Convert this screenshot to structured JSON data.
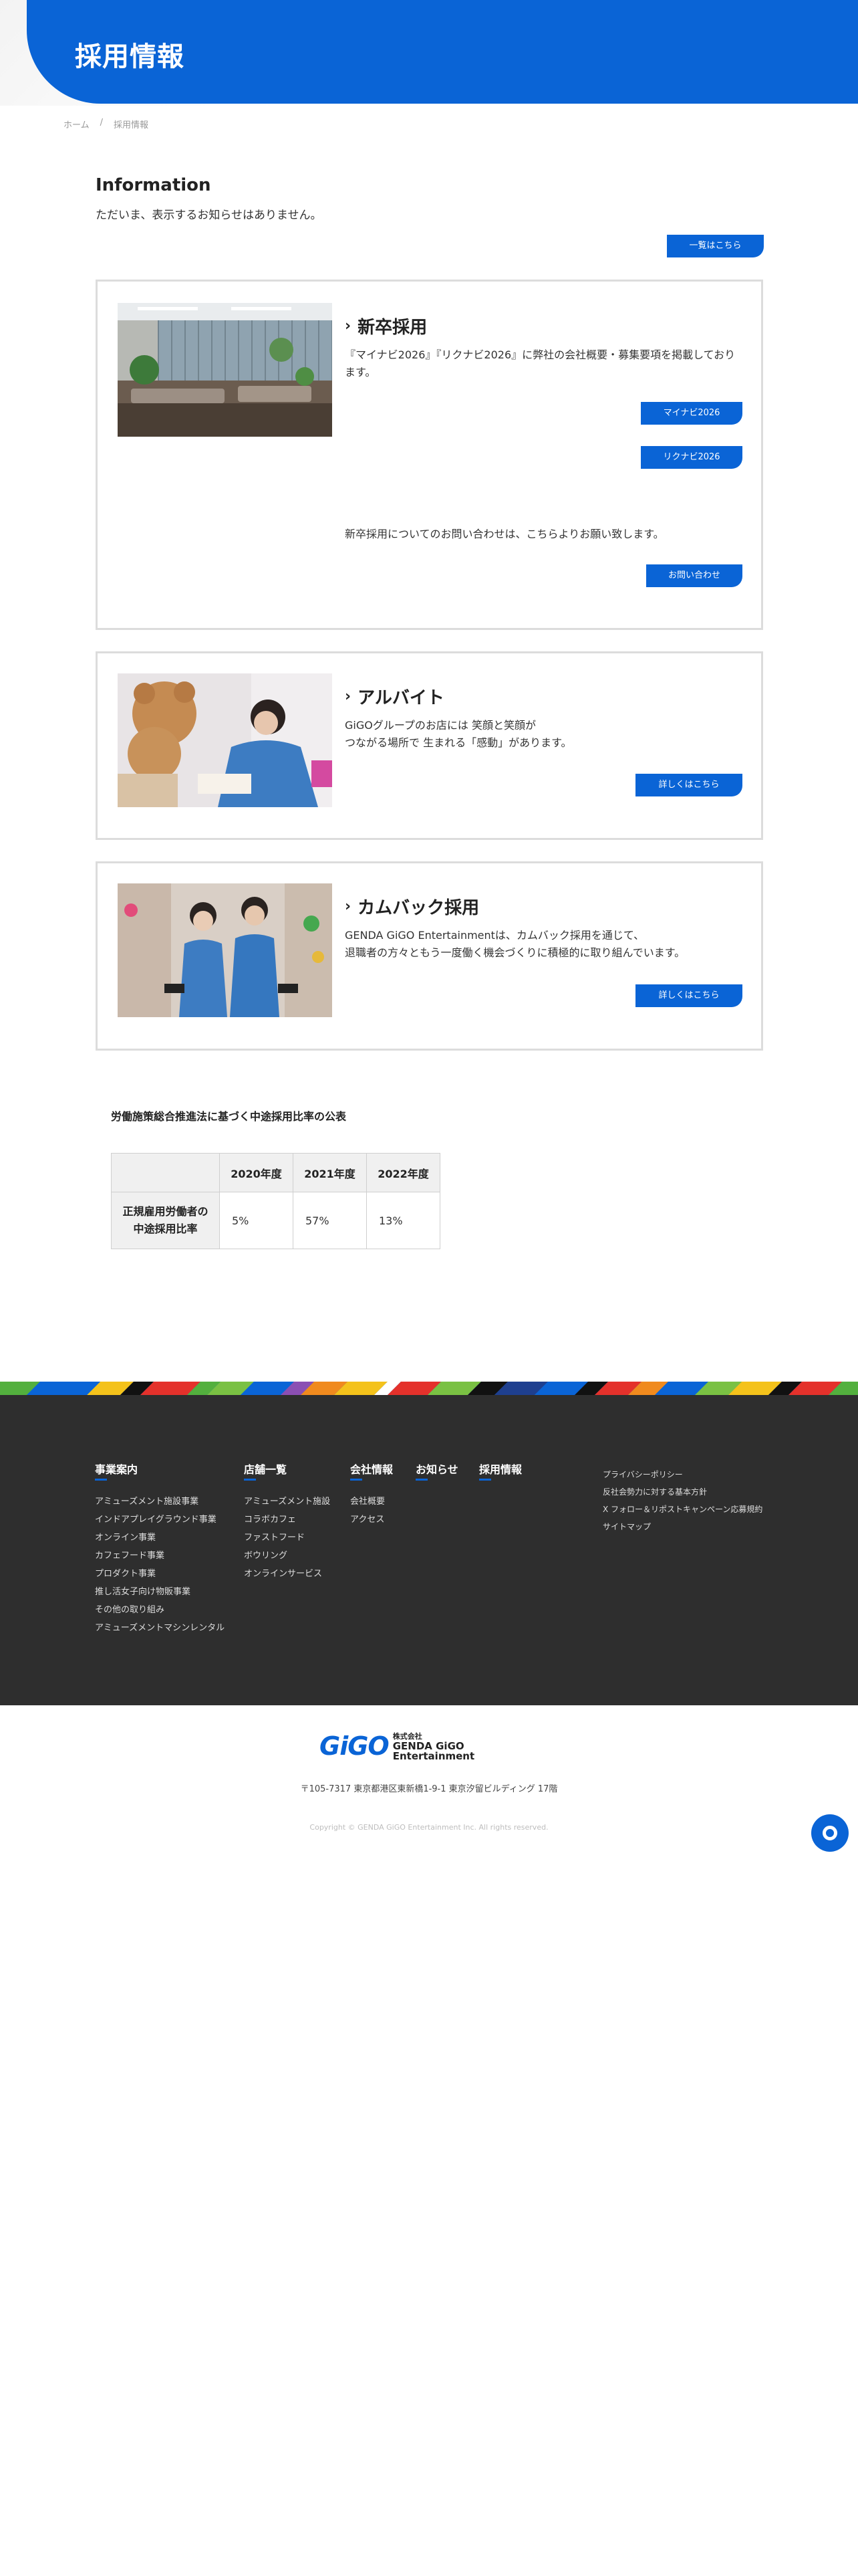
{
  "header": {
    "title": "採用情報"
  },
  "breadcrumb": {
    "home": "ホーム",
    "sep": "/",
    "current": "採用情報"
  },
  "information": {
    "title": "Information",
    "message": "ただいま、表示するお知らせはありません。",
    "list_button": "一覧はこちら"
  },
  "cards": {
    "newgrad": {
      "title": "新卒採用",
      "desc": "『マイナビ2026』『リクナビ2026』に弊社の会社概要・募集要項を掲載しており\nます。",
      "btn1": "マイナビ2026",
      "btn2": "リクナビ2026",
      "contact_text": "新卒採用についてのお問い合わせは、こちらよりお願い致します。",
      "contact_btn": "お問い合わせ"
    },
    "parttime": {
      "title": "アルバイト",
      "desc": "GiGOグループのお店には 笑顔と笑顔が\nつながる場所で 生まれる「感動」があります。",
      "btn": "詳しくはこちら"
    },
    "comeback": {
      "title": "カムバック採用",
      "desc": "GENDA GiGO Entertainmentは、カムバック採用を通じて、\n退職者の方々ともう一度働く機会づくりに積極的に取り組んでいます。",
      "btn": "詳しくはこちら"
    }
  },
  "law": {
    "title": "労働施策総合推進法に基づく中途採用比率の公表",
    "headers": [
      "2020年度",
      "2021年度",
      "2022年度"
    ],
    "row_label_1": "正規雇用労働者の",
    "row_label_2": "中途採用比率",
    "values": [
      "5%",
      "57%",
      "13%"
    ]
  },
  "footer": {
    "business": {
      "title": "事業案内",
      "items": [
        "アミューズメント施設事業",
        "インドアプレイグラウンド事業",
        "オンライン事業",
        "カフェフード事業",
        "プロダクト事業",
        "推し活女子向け物販事業",
        "その他の取り組み",
        "アミューズメントマシンレンタル"
      ]
    },
    "stores": {
      "title": "店舗一覧",
      "items": [
        "アミューズメント施設",
        "コラボカフェ",
        "ファストフード",
        "ボウリング",
        "オンラインサービス"
      ]
    },
    "company": {
      "title": "会社情報",
      "items": [
        "会社概要",
        "アクセス"
      ]
    },
    "news": {
      "title": "お知らせ"
    },
    "recruit": {
      "title": "採用情報"
    },
    "side_links": [
      "プライバシーポリシー",
      "反社会勢力に対する基本方針",
      "X フォロー＆リポストキャンペーン応募規約",
      "サイトマップ"
    ]
  },
  "bottom": {
    "logo_mark": "GiGO",
    "logo_small": "株式会社",
    "logo_big": "GENDA GiGO Entertainment",
    "address": "〒105-7317 東京都港区東新橋1-9-1 東京汐留ビルディング 17階",
    "copyright": "Copyright © GENDA GiGO Entertainment Inc. All rights reserved."
  },
  "colors": {
    "brand_blue": "#0a64d6",
    "footer_bg": "#2e2e2e"
  }
}
